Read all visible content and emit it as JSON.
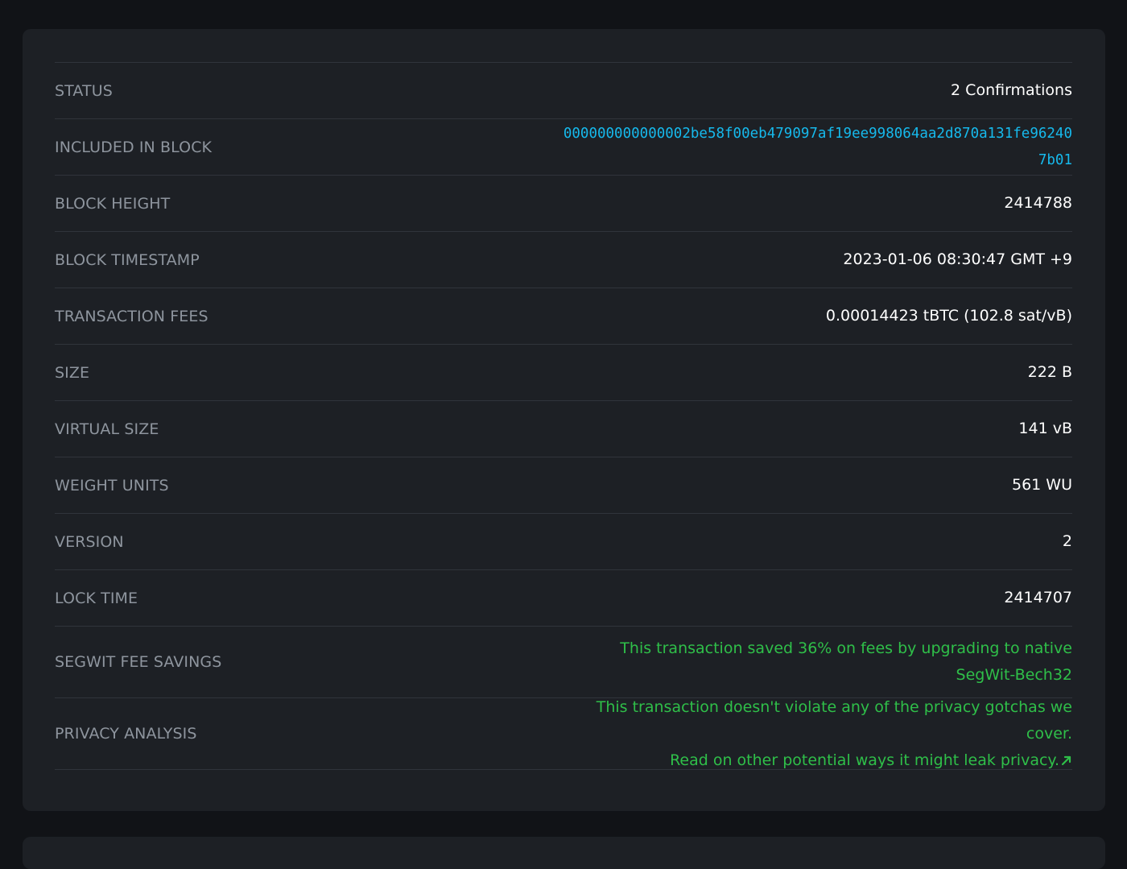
{
  "rows": {
    "status": {
      "label": "STATUS",
      "value": "2 Confirmations"
    },
    "block": {
      "label": "INCLUDED IN BLOCK",
      "value": "000000000000002be58f00eb479097af19ee998064aa2d870a131fe962407b01"
    },
    "height": {
      "label": "BLOCK HEIGHT",
      "value": "2414788"
    },
    "timestamp": {
      "label": "BLOCK TIMESTAMP",
      "value": "2023-01-06 08:30:47 GMT +9"
    },
    "fees": {
      "label": "TRANSACTION FEES",
      "value": "0.00014423 tBTC (102.8 sat/vB)"
    },
    "size": {
      "label": "SIZE",
      "value": "222 B"
    },
    "vsize": {
      "label": "VIRTUAL SIZE",
      "value": "141 vB"
    },
    "weight": {
      "label": "WEIGHT UNITS",
      "value": "561 WU"
    },
    "version": {
      "label": "VERSION",
      "value": "2"
    },
    "locktime": {
      "label": "LOCK TIME",
      "value": "2414707"
    },
    "segwit": {
      "label": "SEGWIT FEE SAVINGS",
      "value": "This transaction saved 36% on fees by upgrading to native SegWit-Bech32"
    },
    "privacy": {
      "label": "PRIVACY ANALYSIS",
      "line1": "This transaction doesn't violate any of the privacy gotchas we cover.",
      "link": "Read on other potential ways it might leak privacy.",
      "icon": "external-link-icon"
    }
  },
  "colors": {
    "background": "#111317",
    "card": "#1d2025",
    "label": "#8e959e",
    "link": "#16b9ec",
    "success": "#2fbf49"
  }
}
